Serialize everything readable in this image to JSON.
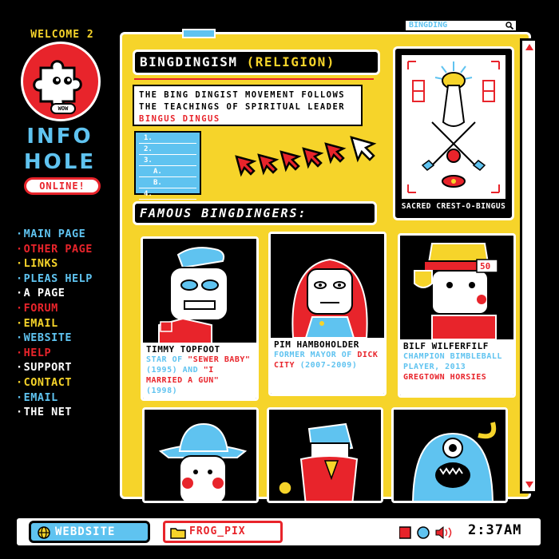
{
  "sidebar": {
    "welcome": "WELCOME 2",
    "logo_badge": "WOW",
    "title_line1": "INFO",
    "title_line2": "HOLE",
    "online": "ONLINE!",
    "nav": [
      {
        "label": "MAIN PAGE",
        "color": "#5fc3f0"
      },
      {
        "label": "OTHER PAGE",
        "color": "#e8242b"
      },
      {
        "label": "LINKS",
        "color": "#f6d42a"
      },
      {
        "label": "PLEAS HELP",
        "color": "#5fc3f0"
      },
      {
        "label": "A PAGE",
        "color": "#ffffff"
      },
      {
        "label": "FORUM",
        "color": "#e8242b"
      },
      {
        "label": "EMAIL",
        "color": "#f6d42a"
      },
      {
        "label": "WEBSITE",
        "color": "#5fc3f0"
      },
      {
        "label": "HELP",
        "color": "#e8242b"
      },
      {
        "label": "SUPPORT",
        "color": "#ffffff"
      },
      {
        "label": "CONTACT",
        "color": "#f6d42a"
      },
      {
        "label": "EMAIL",
        "color": "#5fc3f0"
      },
      {
        "label": "THE NET",
        "color": "#ffffff"
      }
    ]
  },
  "browser": {
    "search_value": "BINGDING",
    "search_icon": "magnifier-icon"
  },
  "article": {
    "title": "BINGDINGISM",
    "title_tag": "(RELIGION)",
    "intro_prefix": "THE BING DINGIST MOVEMENT FOLLOWS THE TEACHINGS OF SPIRITUAL LEADER ",
    "intro_highlight": "BINGUS DINGUS",
    "toc": [
      "1.",
      "2.",
      "3.",
      "A.",
      "B.",
      "4."
    ],
    "crest_caption": "SACRED CREST-O-BINGUS",
    "famous_heading": "FAMOUS BINGDINGERS:"
  },
  "people": [
    {
      "name": "TIMMY TOPFOOT",
      "desc_parts": [
        {
          "text": "STAR OF ",
          "accent": false
        },
        {
          "text": "\"SEWER BABY\"",
          "accent": true
        },
        {
          "text": " (1995) AND ",
          "accent": false
        },
        {
          "text": "\"I MARRIED A GUN\"",
          "accent": true
        },
        {
          "text": " (1998)",
          "accent": false
        }
      ]
    },
    {
      "name": "PIM HAMBOHOLDER",
      "desc_parts": [
        {
          "text": "FORMER MAYOR OF ",
          "accent": false
        },
        {
          "text": "DICK CITY",
          "accent": true
        },
        {
          "text": " (2007-2009)",
          "accent": false
        }
      ]
    },
    {
      "name": "BILF WILFERFILF",
      "desc_parts": [
        {
          "text": "CHAMPION BIMBLEBALL PLAYER, 2013 ",
          "accent": false
        },
        {
          "text": "GREGTOWN HORSIES",
          "accent": true
        }
      ]
    }
  ],
  "portrait_badge": "50",
  "taskbar": {
    "start_label": "WEBDSITE",
    "folder_label": "FROG_PIX",
    "clock": "2:37AM"
  },
  "colors": {
    "yellow": "#f6d42a",
    "red": "#e8242b",
    "blue": "#5fc3f0",
    "black": "#000000",
    "white": "#ffffff"
  }
}
